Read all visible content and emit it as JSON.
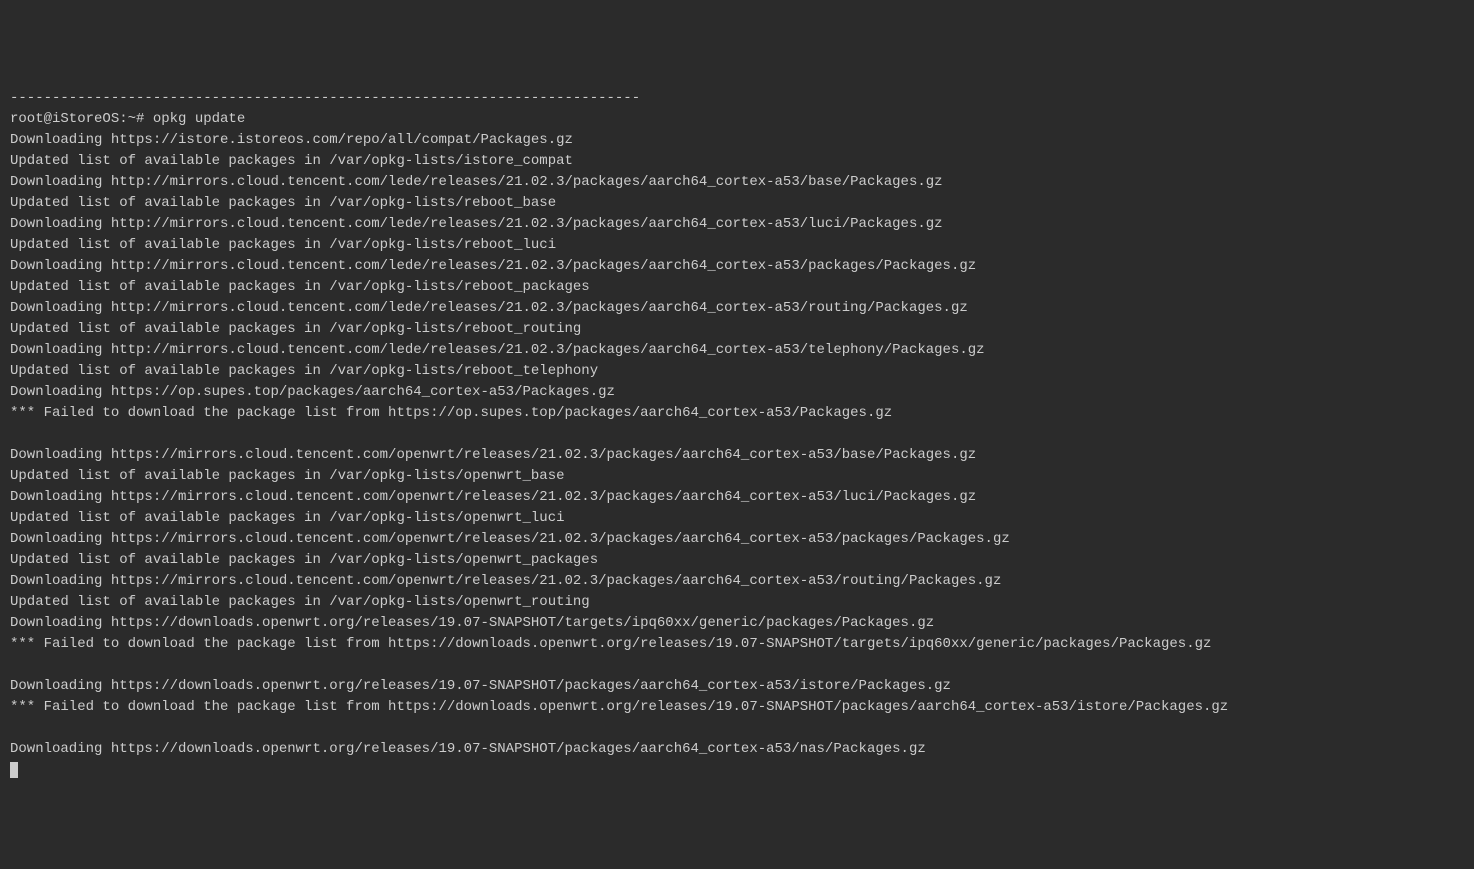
{
  "terminal": {
    "lines": [
      "---------------------------------------------------------------------------",
      "root@iStoreOS:~# opkg update",
      "Downloading https://istore.istoreos.com/repo/all/compat/Packages.gz",
      "Updated list of available packages in /var/opkg-lists/istore_compat",
      "Downloading http://mirrors.cloud.tencent.com/lede/releases/21.02.3/packages/aarch64_cortex-a53/base/Packages.gz",
      "Updated list of available packages in /var/opkg-lists/reboot_base",
      "Downloading http://mirrors.cloud.tencent.com/lede/releases/21.02.3/packages/aarch64_cortex-a53/luci/Packages.gz",
      "Updated list of available packages in /var/opkg-lists/reboot_luci",
      "Downloading http://mirrors.cloud.tencent.com/lede/releases/21.02.3/packages/aarch64_cortex-a53/packages/Packages.gz",
      "Updated list of available packages in /var/opkg-lists/reboot_packages",
      "Downloading http://mirrors.cloud.tencent.com/lede/releases/21.02.3/packages/aarch64_cortex-a53/routing/Packages.gz",
      "Updated list of available packages in /var/opkg-lists/reboot_routing",
      "Downloading http://mirrors.cloud.tencent.com/lede/releases/21.02.3/packages/aarch64_cortex-a53/telephony/Packages.gz",
      "Updated list of available packages in /var/opkg-lists/reboot_telephony",
      "Downloading https://op.supes.top/packages/aarch64_cortex-a53/Packages.gz",
      "*** Failed to download the package list from https://op.supes.top/packages/aarch64_cortex-a53/Packages.gz",
      "",
      "Downloading https://mirrors.cloud.tencent.com/openwrt/releases/21.02.3/packages/aarch64_cortex-a53/base/Packages.gz",
      "Updated list of available packages in /var/opkg-lists/openwrt_base",
      "Downloading https://mirrors.cloud.tencent.com/openwrt/releases/21.02.3/packages/aarch64_cortex-a53/luci/Packages.gz",
      "Updated list of available packages in /var/opkg-lists/openwrt_luci",
      "Downloading https://mirrors.cloud.tencent.com/openwrt/releases/21.02.3/packages/aarch64_cortex-a53/packages/Packages.gz",
      "Updated list of available packages in /var/opkg-lists/openwrt_packages",
      "Downloading https://mirrors.cloud.tencent.com/openwrt/releases/21.02.3/packages/aarch64_cortex-a53/routing/Packages.gz",
      "Updated list of available packages in /var/opkg-lists/openwrt_routing",
      "Downloading https://downloads.openwrt.org/releases/19.07-SNAPSHOT/targets/ipq60xx/generic/packages/Packages.gz",
      "*** Failed to download the package list from https://downloads.openwrt.org/releases/19.07-SNAPSHOT/targets/ipq60xx/generic/packages/Packages.gz",
      "",
      "Downloading https://downloads.openwrt.org/releases/19.07-SNAPSHOT/packages/aarch64_cortex-a53/istore/Packages.gz",
      "*** Failed to download the package list from https://downloads.openwrt.org/releases/19.07-SNAPSHOT/packages/aarch64_cortex-a53/istore/Packages.gz",
      "",
      "Downloading https://downloads.openwrt.org/releases/19.07-SNAPSHOT/packages/aarch64_cortex-a53/nas/Packages.gz"
    ]
  }
}
